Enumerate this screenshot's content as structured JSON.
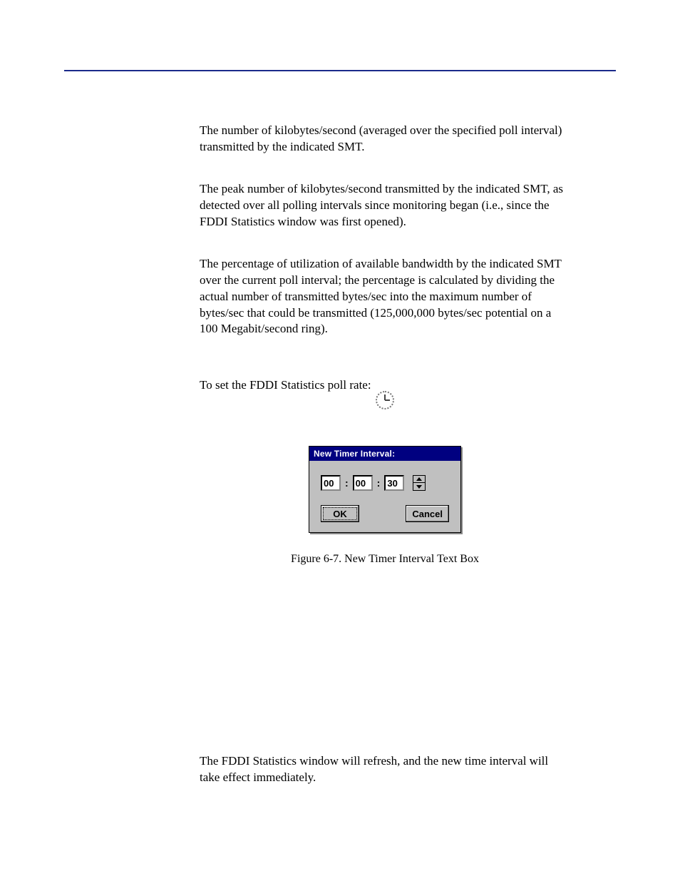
{
  "paragraphs": {
    "p1": "The number of kilobytes/second (averaged over the specified poll interval) transmitted by the indicated SMT.",
    "p2": "The peak number of kilobytes/second transmitted by the indicated SMT, as detected over all polling intervals since monitoring began (i.e., since the FDDI Statistics window was first opened).",
    "p3": "The percentage of utilization of available bandwidth by the indicated SMT over the current poll interval; the percentage is calculated by dividing the actual number of transmitted bytes/sec into the maximum number of bytes/sec that could be transmitted (125,000,000 bytes/sec potential on a 100 Megabit/second ring).",
    "instr": "To set the FDDI Statistics poll rate:",
    "footer": "The FDDI Statistics window will refresh, and the new time interval will take effect immediately."
  },
  "dialog": {
    "title": "New Timer Interval:",
    "hh": "00",
    "mm": "00",
    "ss": "30",
    "ok": "OK",
    "cancel": "Cancel"
  },
  "figure": {
    "caption": "Figure 6-7.  New Timer Interval Text Box"
  }
}
